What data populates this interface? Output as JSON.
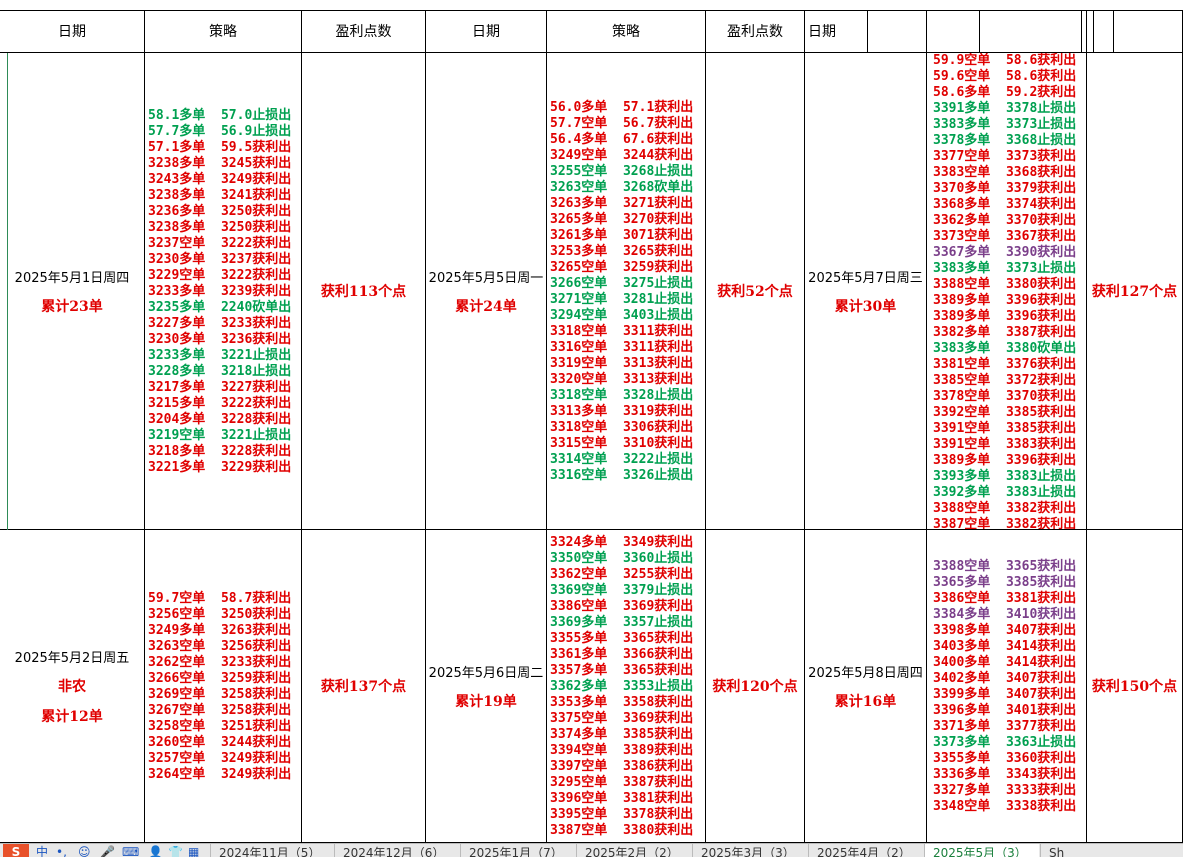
{
  "headers": {
    "date": "日期",
    "strategy": "策略",
    "profit": "盈利点数"
  },
  "days": [
    {
      "date": "2025年5月1日周四",
      "count": "累计23单",
      "profit": "获利113个点",
      "lines": [
        [
          "58.1多单  57.0止损出",
          "g"
        ],
        [
          "57.7多单  56.9止损出",
          "g"
        ],
        [
          "57.1多单  59.5获利出",
          "r"
        ],
        [
          "3238多单  3245获利出",
          "r"
        ],
        [
          "3243多单  3249获利出",
          "r"
        ],
        [
          "3238多单  3241获利出",
          "r"
        ],
        [
          "3236多单  3250获利出",
          "r"
        ],
        [
          "3238多单  3250获利出",
          "r"
        ],
        [
          "3237空单  3222获利出",
          "r"
        ],
        [
          "3230多单  3237获利出",
          "r"
        ],
        [
          "3229空单  3222获利出",
          "r"
        ],
        [
          "3233多单  3239获利出",
          "r"
        ],
        [
          "3235多单  2240砍单出",
          "g"
        ],
        [
          "3227多单  3233获利出",
          "r"
        ],
        [
          "3230多单  3236获利出",
          "r"
        ],
        [
          "3233多单  3221止损出",
          "g"
        ],
        [
          "3228多单  3218止损出",
          "g"
        ],
        [
          "3217多单  3227获利出",
          "r"
        ],
        [
          "3215多单  3222获利出",
          "r"
        ],
        [
          "3204多单  3228获利出",
          "r"
        ],
        [
          "3219空单  3221止损出",
          "g"
        ],
        [
          "3218多单  3228获利出",
          "r"
        ],
        [
          "3221多单  3229获利出",
          "r"
        ]
      ]
    },
    {
      "date": "2025年5月5日周一",
      "count": "累计24单",
      "profit": "获利52个点",
      "lines": [
        [
          "56.0多单  57.1获利出",
          "r"
        ],
        [
          "57.7空单  56.7获利出",
          "r"
        ],
        [
          "56.4多单  67.6获利出",
          "r"
        ],
        [
          "3249空单  3244获利出",
          "r"
        ],
        [
          "3255空单  3268止损出",
          "g"
        ],
        [
          "3263空单  3268砍单出",
          "g"
        ],
        [
          "3263多单  3271获利出",
          "r"
        ],
        [
          "3265多单  3270获利出",
          "r"
        ],
        [
          "3261多单  3071获利出",
          "r"
        ],
        [
          "3253多单  3265获利出",
          "r"
        ],
        [
          "3265空单  3259获利出",
          "r"
        ],
        [
          "3266空单  3275止损出",
          "g"
        ],
        [
          "3271空单  3281止损出",
          "g"
        ],
        [
          "3294空单  3403止损出",
          "g"
        ],
        [
          "3318空单  3311获利出",
          "r"
        ],
        [
          "3316空单  3311获利出",
          "r"
        ],
        [
          "3319空单  3313获利出",
          "r"
        ],
        [
          "3320空单  3313获利出",
          "r"
        ],
        [
          "3318空单  3328止损出",
          "g"
        ],
        [
          "3313多单  3319获利出",
          "r"
        ],
        [
          "3318空单  3306获利出",
          "r"
        ],
        [
          "3315空单  3310获利出",
          "r"
        ],
        [
          "3314空单  3222止损出",
          "g"
        ],
        [
          "3316空单  3326止损出",
          "g"
        ]
      ]
    },
    {
      "date": "2025年5月7日周三",
      "count": "累计30单",
      "profit": "获利127个点",
      "lines": [
        [
          "59.9空单  58.6获利出",
          "r"
        ],
        [
          "59.6空单  58.6获利出",
          "r"
        ],
        [
          "58.6多单  59.2获利出",
          "r"
        ],
        [
          "3391多单  3378止损出",
          "g"
        ],
        [
          "3383多单  3373止损出",
          "g"
        ],
        [
          "3378多单  3368止损出",
          "g"
        ],
        [
          "3377空单  3373获利出",
          "r"
        ],
        [
          "3383空单  3368获利出",
          "r"
        ],
        [
          "3370多单  3379获利出",
          "r"
        ],
        [
          "3368多单  3374获利出",
          "r"
        ],
        [
          "3362多单  3370获利出",
          "r"
        ],
        [
          "3373空单  3367获利出",
          "r"
        ],
        [
          "3367多单  3390获利出",
          "p"
        ],
        [
          "3383多单  3373止损出",
          "g"
        ],
        [
          "3388空单  3380获利出",
          "r"
        ],
        [
          "3389多单  3396获利出",
          "r"
        ],
        [
          "3389多单  3396获利出",
          "r"
        ],
        [
          "3382多单  3387获利出",
          "r"
        ],
        [
          "3383多单  3380砍单出",
          "g"
        ],
        [
          "3381空单  3376获利出",
          "r"
        ],
        [
          "3385空单  3372获利出",
          "r"
        ],
        [
          "3378空单  3370获利出",
          "r"
        ],
        [
          "3392空单  3385获利出",
          "r"
        ],
        [
          "3391空单  3385获利出",
          "r"
        ],
        [
          "3391空单  3383获利出",
          "r"
        ],
        [
          "3389多单  3396获利出",
          "r"
        ],
        [
          "3393多单  3383止损出",
          "g"
        ],
        [
          "3392多单  3383止损出",
          "g"
        ],
        [
          "3388空单  3382获利出",
          "r"
        ],
        [
          "3387空单  3382获利出",
          "r"
        ]
      ]
    },
    {
      "date": "2025年5月2日周五",
      "note": "非农",
      "count": "累计12单",
      "profit": "获利137个点",
      "lines": [
        [
          "59.7空单  58.7获利出",
          "r"
        ],
        [
          "3256空单  3250获利出",
          "r"
        ],
        [
          "3249多单  3263获利出",
          "r"
        ],
        [
          "3263空单  3256获利出",
          "r"
        ],
        [
          "3262空单  3233获利出",
          "r"
        ],
        [
          "3266空单  3259获利出",
          "r"
        ],
        [
          "3269空单  3258获利出",
          "r"
        ],
        [
          "3267空单  3258获利出",
          "r"
        ],
        [
          "3258空单  3251获利出",
          "r"
        ],
        [
          "3260空单  3244获利出",
          "r"
        ],
        [
          "3257空单  3249获利出",
          "r"
        ],
        [
          "3264空单  3249获利出",
          "r"
        ]
      ]
    },
    {
      "date": "2025年5月6日周二",
      "count": "累计19单",
      "profit": "获利120个点",
      "lines": [
        [
          "3324多单  3349获利出",
          "r"
        ],
        [
          "3350空单  3360止损出",
          "g"
        ],
        [
          "3362空单  3255获利出",
          "r"
        ],
        [
          "3369空单  3379止损出",
          "g"
        ],
        [
          "3386空单  3369获利出",
          "r"
        ],
        [
          "3369多单  3357止损出",
          "g"
        ],
        [
          "3355多单  3365获利出",
          "r"
        ],
        [
          "3361多单  3366获利出",
          "r"
        ],
        [
          "3357多单  3365获利出",
          "r"
        ],
        [
          "3362多单  3353止损出",
          "g"
        ],
        [
          "3353多单  3358获利出",
          "r"
        ],
        [
          "3375空单  3369获利出",
          "r"
        ],
        [
          "3374多单  3385获利出",
          "r"
        ],
        [
          "3394空单  3389获利出",
          "r"
        ],
        [
          "3397空单  3386获利出",
          "r"
        ],
        [
          "3295空单  3387获利出",
          "r"
        ],
        [
          "3396空单  3381获利出",
          "r"
        ],
        [
          "3395空单  3378获利出",
          "r"
        ],
        [
          "3387空单  3380获利出",
          "r"
        ]
      ]
    },
    {
      "date": "2025年5月8日周四",
      "count": "累计16单",
      "profit": "获利150个点",
      "lines": [
        [
          "3388空单  3365获利出",
          "p"
        ],
        [
          "3365多单  3385获利出",
          "p"
        ],
        [
          "3386空单  3381获利出",
          "r"
        ],
        [
          "3384多单  3410获利出",
          "p"
        ],
        [
          "3398多单  3407获利出",
          "r"
        ],
        [
          "3403多单  3414获利出",
          "r"
        ],
        [
          "3400多单  3414获利出",
          "r"
        ],
        [
          "3402多单  3407获利出",
          "r"
        ],
        [
          "3399多单  3407获利出",
          "r"
        ],
        [
          "3396多单  3401获利出",
          "r"
        ],
        [
          "3371多单  3377获利出",
          "r"
        ],
        [
          "3373多单  3363止损出",
          "g"
        ],
        [
          "3355多单  3360获利出",
          "r"
        ],
        [
          "3336多单  3343获利出",
          "r"
        ],
        [
          "3327多单  3333获利出",
          "r"
        ],
        [
          "3348空单  3338获利出",
          "r"
        ]
      ]
    }
  ],
  "sheet_tabs": {
    "items": [
      "2024年11月（5）",
      "2024年12月（6）",
      "2025年1月（7）",
      "2025年2月（2）",
      "2025年3月（3）",
      "2025年4月（2）",
      "2025年5月（3）",
      "Sh"
    ],
    "active": "2025年5月（3）"
  },
  "icon_names": [
    "sogou-s-icon",
    "chinese-input-icon",
    "punctuation-icon",
    "emoji-icon",
    "microphone-icon",
    "keyboard-icon",
    "user-icon",
    "shirt-icon",
    "grid-icon"
  ]
}
